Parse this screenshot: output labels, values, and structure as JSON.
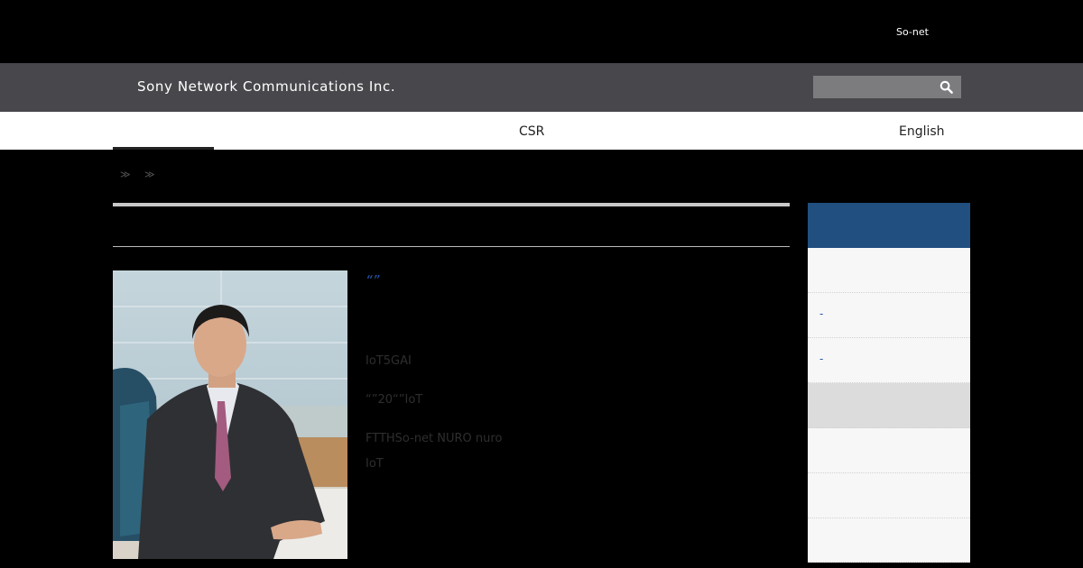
{
  "topbar": {
    "sonet_link": "So-net"
  },
  "brand": {
    "company_name": "Sony Network Communications Inc."
  },
  "search": {
    "placeholder": "",
    "value": "",
    "icon": "search-icon"
  },
  "nav": {
    "items": [
      "CSR",
      "English"
    ]
  },
  "breadcrumb": {
    "separators": [
      "≫",
      "≫"
    ]
  },
  "article": {
    "quote": "“”",
    "paragraphs": [
      "IoT5GAI",
      "“”20“”IoT",
      "FTTHSo-net  NURO nuro",
      "IoT"
    ]
  },
  "sidebar": {
    "items": [
      "",
      "-",
      "-",
      "",
      "",
      "",
      ""
    ]
  },
  "colors": {
    "brand_bar": "#48484c",
    "sidebar_header": "#214f80",
    "accent_link": "#2a57a8"
  }
}
